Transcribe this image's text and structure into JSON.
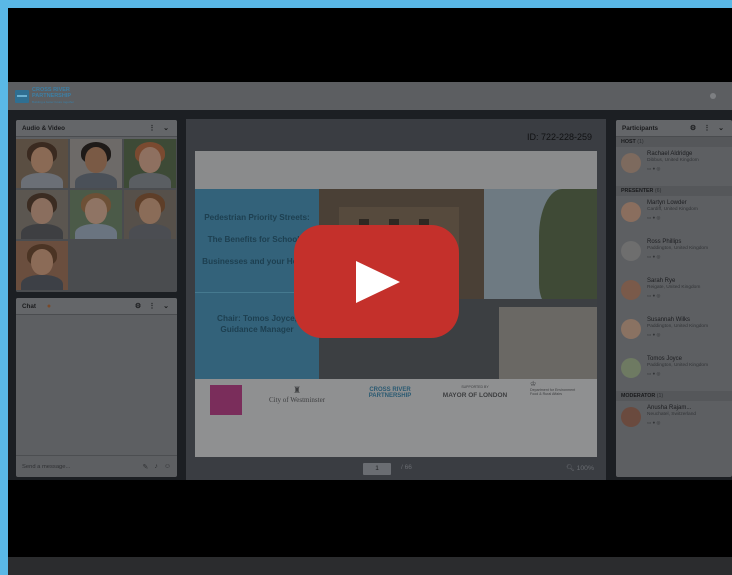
{
  "app": {
    "logo_line1": "CROSS RIVER",
    "logo_line2": "PARTNERSHIP",
    "logo_tagline": "Building a better future together"
  },
  "audio_video": {
    "title": "Audio & Video",
    "tiles": [
      {
        "bg": "#5a4e42",
        "skin": "#8a6a55",
        "hair": "#3a2a20",
        "shirt": "#6b6f76"
      },
      {
        "bg": "#6d6a68",
        "skin": "#7a5a45",
        "hair": "#1e1a18",
        "shirt": "#4a5058"
      },
      {
        "bg": "#3d4a36",
        "skin": "#8e7060",
        "hair": "#7a4a30",
        "shirt": "#5a5e62"
      },
      {
        "bg": "#5b5650",
        "skin": "#8a6e5e",
        "hair": "#3b2c22",
        "shirt": "#3e3f42"
      },
      {
        "bg": "#4b5a48",
        "skin": "#8f7464",
        "hair": "#6d5036",
        "shirt": "#6a7480"
      },
      {
        "bg": "#56504a",
        "skin": "#8a6c58",
        "hair": "#5e3e28",
        "shirt": "#4b4d52"
      },
      {
        "bg": "#6a4e3e",
        "skin": "#8b6b57",
        "hair": "#4b3424",
        "shirt": "#3d4046"
      }
    ]
  },
  "chat": {
    "title": "Chat",
    "placeholder": "Send a message..."
  },
  "stage": {
    "meeting_id": "ID: 722-228-259",
    "slide_title": "Pedestrian Priority Streets: The Benefits for Schools, Businesses and your Health",
    "slide_chair": "Chair: Tomos Joyce, Guidance Manager",
    "sponsor_logos": {
      "city": "City of Westminster",
      "crp": "CROSS RIVER PARTNERSHIP",
      "supported_by": "SUPPORTED BY",
      "mayor": "MAYOR OF LONDON",
      "defra": "Department for Environment Food & Rural Affairs"
    },
    "page_current": "1",
    "page_total": "/ 66",
    "zoom": "100%"
  },
  "participants": {
    "title": "Participants",
    "sections": [
      {
        "label": "HOST",
        "count": "(1)",
        "people": [
          {
            "name": "Rachael Aldridge",
            "location": "Dibbus, United Kingdom",
            "color": "#7d6a5e"
          }
        ]
      },
      {
        "label": "PRESENTER",
        "count": "(6)",
        "people": [
          {
            "name": "Martyn Lowder",
            "location": "Cardiff, United Kingdom",
            "color": "#8a6e5e"
          },
          {
            "name": "Ross Phillips",
            "location": "Paddington, United Kingdom",
            "color": "#6e6e6e"
          },
          {
            "name": "Sarah Rye",
            "location": "Reigate, United Kingdom",
            "color": "#7a5a4a"
          },
          {
            "name": "Susannah Wilks",
            "location": "Paddington, United Kingdom",
            "color": "#8a7262"
          },
          {
            "name": "Tomos Joyce",
            "location": "Paddington, United Kingdom",
            "color": "#6e7a62"
          }
        ]
      },
      {
        "label": "MODERATOR",
        "count": "(1)",
        "people": [
          {
            "name": "Anusha Rajam...",
            "location": "Neuchatel, Switzerland",
            "color": "#6a4a3e"
          }
        ]
      }
    ]
  },
  "colors": {
    "border": "#5ab8e6",
    "play_button": "#c4302b"
  }
}
